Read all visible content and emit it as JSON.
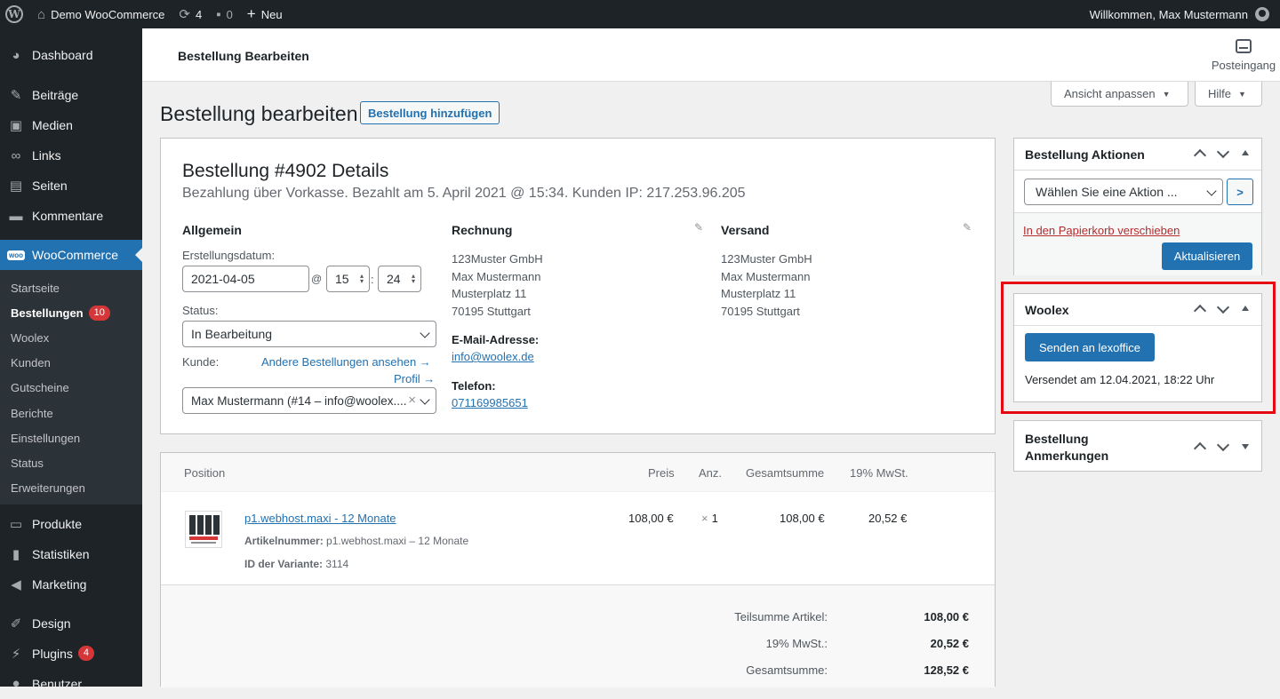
{
  "adminbar": {
    "site_name": "Demo WooCommerce",
    "updates_count": "4",
    "comments_count": "0",
    "new_label": "Neu",
    "welcome": "Willkommen, Max Mustermann"
  },
  "sidebar": {
    "items_top": [
      {
        "label": "Dashboard",
        "icon": "dashboard-icon"
      },
      {
        "label": "Beiträge",
        "icon": "pin-icon"
      },
      {
        "label": "Medien",
        "icon": "media-icon"
      },
      {
        "label": "Links",
        "icon": "link-icon"
      },
      {
        "label": "Seiten",
        "icon": "pages-icon"
      },
      {
        "label": "Kommentare",
        "icon": "comment-icon"
      }
    ],
    "woocommerce": "WooCommerce",
    "woo_icon_text": "woo",
    "submenu": [
      {
        "label": "Startseite"
      },
      {
        "label": "Bestellungen",
        "badge": "10"
      },
      {
        "label": "Woolex"
      },
      {
        "label": "Kunden"
      },
      {
        "label": "Gutscheine"
      },
      {
        "label": "Berichte"
      },
      {
        "label": "Einstellungen"
      },
      {
        "label": "Status"
      },
      {
        "label": "Erweiterungen"
      }
    ],
    "items_bottom": [
      {
        "label": "Produkte"
      },
      {
        "label": "Statistiken"
      },
      {
        "label": "Marketing"
      },
      {
        "label": "Design"
      },
      {
        "label": "Plugins",
        "badge": "4"
      },
      {
        "label": "Benutzer"
      }
    ]
  },
  "header": {
    "title": "Bestellung Bearbeiten",
    "inbox": "Posteingang",
    "screen_options": "Ansicht anpassen",
    "help": "Hilfe"
  },
  "page": {
    "title": "Bestellung bearbeiten",
    "add_button": "Bestellung hinzufügen"
  },
  "order": {
    "heading": "Bestellung #4902 Details",
    "meta": "Bezahlung über Vorkasse. Bezahlt am 5. April 2021 @ 15:34. Kunden IP: 217.253.96.205",
    "general": {
      "heading": "Allgemein",
      "date_label": "Erstellungsdatum:",
      "date": "2021-04-05",
      "at": "@",
      "hour": "15",
      "colon": ":",
      "minute": "24",
      "status_label": "Status:",
      "status": "In Bearbeitung",
      "customer_label": "Kunde:",
      "other_orders": "Andere Bestellungen ansehen →",
      "profile": "Profil →",
      "customer": "Max Mustermann (#14 – info@woolex....",
      "clear": "×"
    },
    "billing": {
      "heading": "Rechnung",
      "lines": [
        "123Muster GmbH",
        "Max Mustermann",
        "Musterplatz 11",
        "70195 Stuttgart"
      ],
      "email_label": "E-Mail-Adresse:",
      "email": "info@woolex.de",
      "phone_label": "Telefon:",
      "phone": "071169985651"
    },
    "shipping": {
      "heading": "Versand",
      "lines": [
        "123Muster GmbH",
        "Max Mustermann",
        "Musterplatz 11",
        "70195 Stuttgart"
      ]
    }
  },
  "items": {
    "columns": {
      "position": "Position",
      "price": "Preis",
      "qty": "Anz.",
      "total": "Gesamtsumme",
      "tax": "19% MwSt."
    },
    "rows": [
      {
        "name": "p1.webhost.maxi - 12 Monate",
        "sku_label": "Artikelnummer:",
        "sku": "p1.webhost.maxi – 12 Monate",
        "variation_label": "ID der Variante:",
        "variation": "3114",
        "price": "108,00 €",
        "qty_x": "×",
        "qty": "1",
        "total": "108,00 €",
        "tax": "20,52 €"
      }
    ],
    "totals": [
      {
        "label": "Teilsumme Artikel:",
        "value": "108,00 €"
      },
      {
        "label": "19% MwSt.:",
        "value": "20,52 €"
      },
      {
        "label": "Gesamtsumme:",
        "value": "128,52 €"
      }
    ]
  },
  "actions_box": {
    "title": "Bestellung Aktionen",
    "select": "Wählen Sie eine Aktion ...",
    "go": ">",
    "trash": "In den Papierkorb verschieben",
    "update": "Aktualisieren"
  },
  "woolex_box": {
    "title": "Woolex",
    "send": "Senden an lexoffice",
    "sent_info": "Versendet am 12.04.2021, 18:22 Uhr"
  },
  "notes_box": {
    "title_line1": "Bestellung",
    "title_line2": "Anmerkungen"
  },
  "colors": {
    "accent": "#2271b1",
    "highlight": "#e50914",
    "badge": "#d63638",
    "sidebar": "#1d2327"
  }
}
